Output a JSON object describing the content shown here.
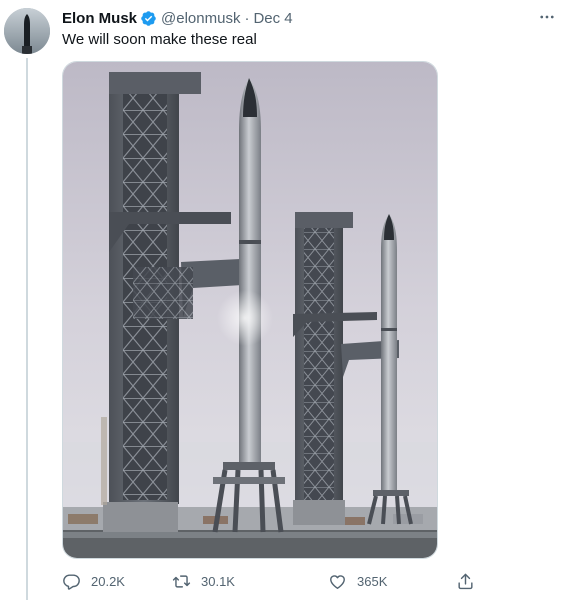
{
  "tweet": {
    "author_name": "Elon Musk",
    "author_handle": "@elonmusk",
    "separator": "·",
    "date": "Dec 4",
    "text": "We will soon make these real",
    "more_icon": "more-icon"
  },
  "metrics": {
    "replies": "20.2K",
    "retweets": "30.1K",
    "likes": "365K"
  },
  "colors": {
    "verified": "#1d9bf0",
    "secondary_text": "#536471",
    "divider": "#cfd9de"
  }
}
